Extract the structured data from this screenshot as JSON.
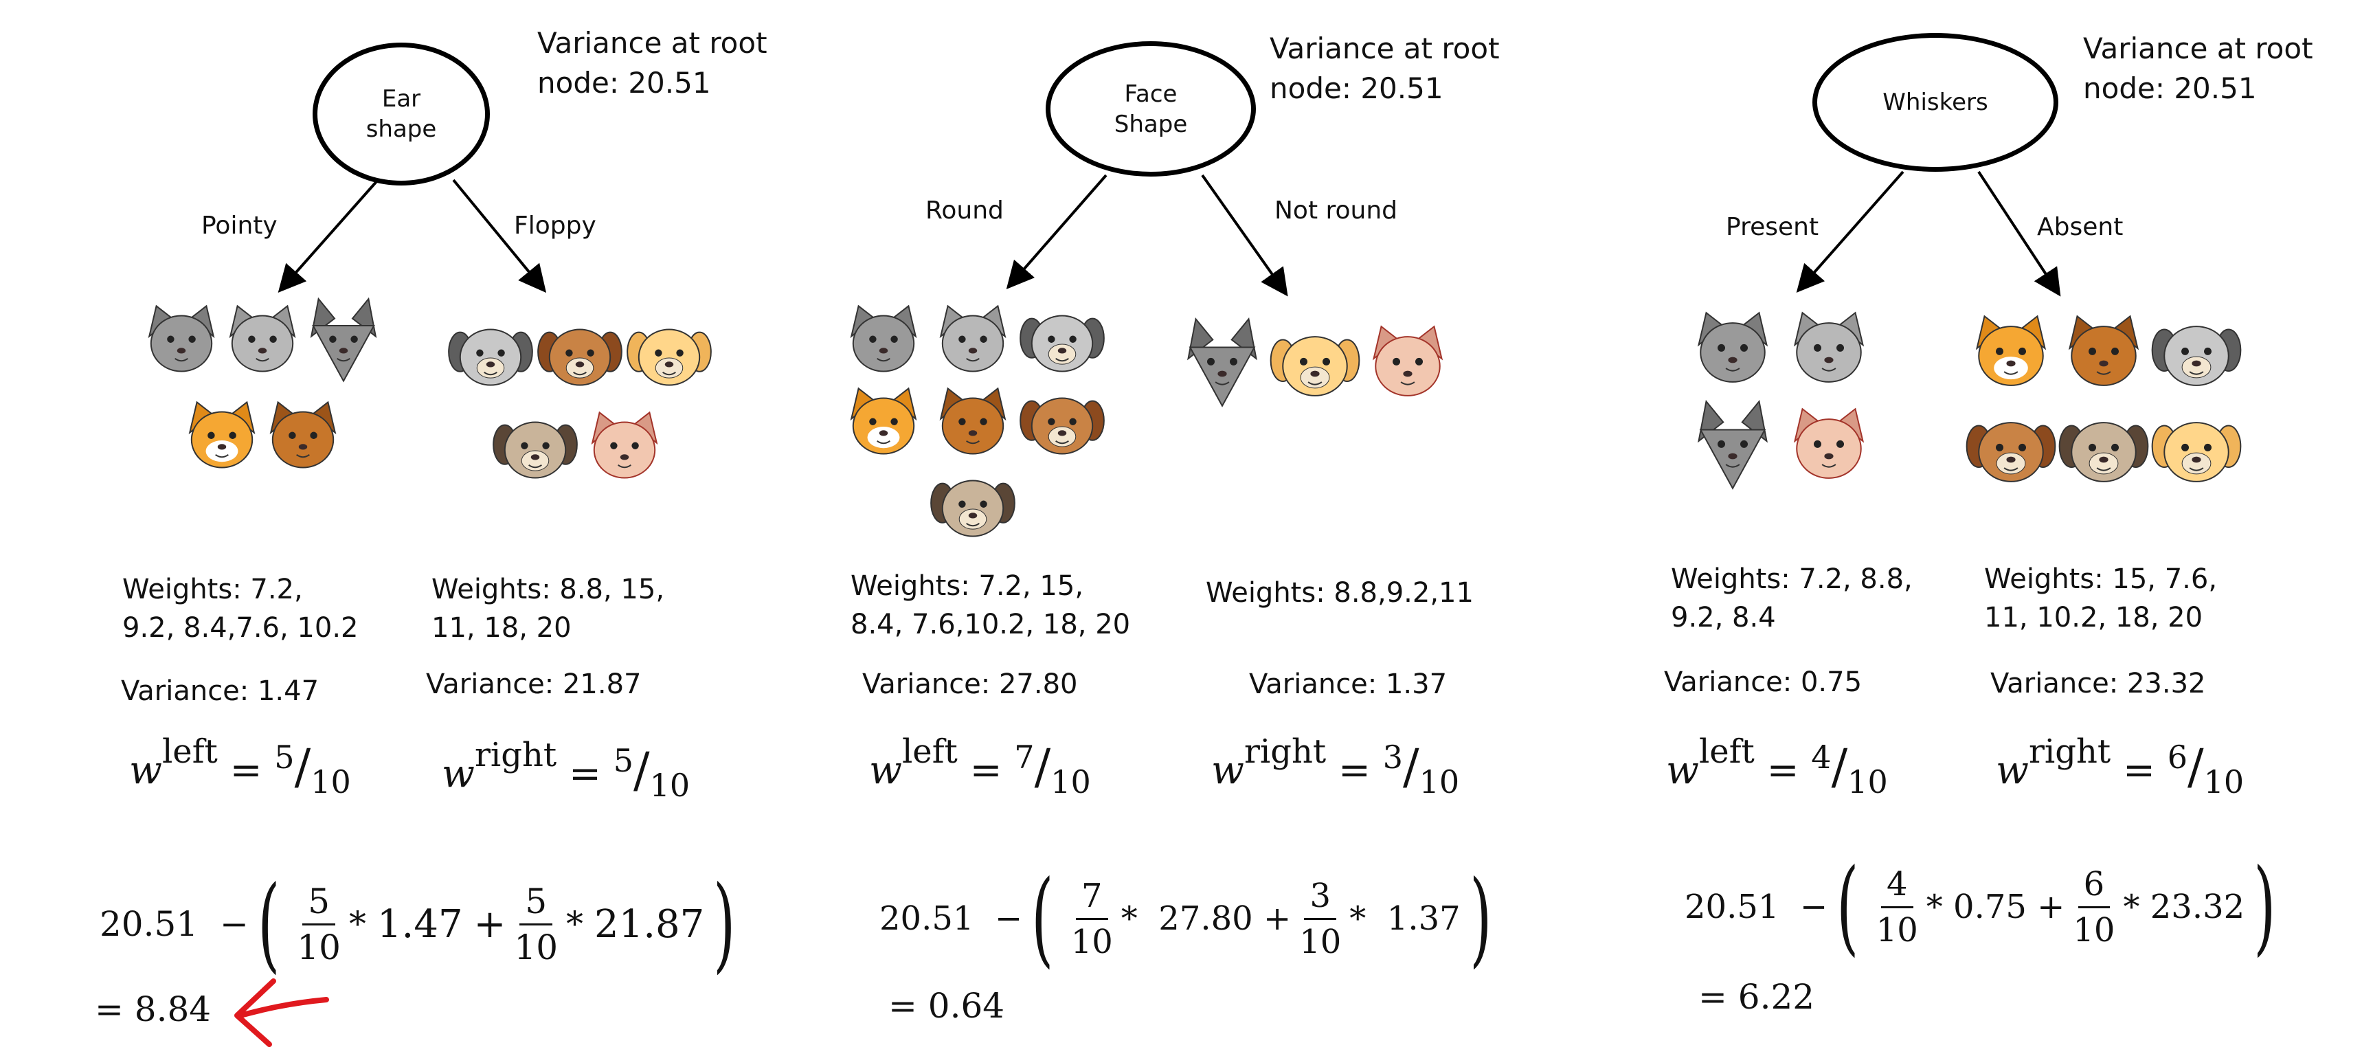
{
  "splits": [
    {
      "feature": [
        "Ear",
        "shape"
      ],
      "root_variance": "Variance at root\nnode: 20.51",
      "left_branch": "Pointy",
      "right_branch": "Floppy",
      "left_weights": "Weights: 7.2,\n9.2, 8.4,7.6, 10.2",
      "right_weights": "Weights: 8.8, 15,\n11, 18, 20",
      "left_variance": "Variance: 1.47",
      "right_variance": "Variance: 21.87",
      "w_left": {
        "num": "5",
        "den": "10"
      },
      "w_right": {
        "num": "5",
        "den": "10"
      },
      "formula": {
        "root": "20.51",
        "minus": "−",
        "left_num": "5",
        "left_den": "10",
        "left_var": "1.47",
        "right_num": "5",
        "right_den": "10",
        "right_var": "21.87"
      },
      "result": "= 8.84",
      "animals_left": [
        "cat-gray",
        "cat-gray-small",
        "cat-wolf",
        "cat-orange-white",
        "cat-brown"
      ],
      "animals_right": [
        "dog-gray",
        "dog-brown",
        "dog-tan",
        "dog-pug",
        "cat-pink"
      ]
    },
    {
      "feature": [
        "Face",
        "Shape"
      ],
      "root_variance": "Variance at root\nnode: 20.51",
      "left_branch": "Round",
      "right_branch": "Not round",
      "left_weights": "Weights: 7.2, 15,\n8.4, 7.6,10.2, 18, 20",
      "right_weights": "Weights: 8.8,9.2,11",
      "left_variance": "Variance: 27.80",
      "right_variance": "Variance: 1.37",
      "w_left": {
        "num": "7",
        "den": "10"
      },
      "w_right": {
        "num": "3",
        "den": "10"
      },
      "formula": {
        "root": "20.51",
        "minus": "−",
        "left_num": "7",
        "left_den": "10",
        "left_var": "27.80",
        "right_num": "3",
        "right_den": "10",
        "right_var": "1.37"
      },
      "result": "= 0.64",
      "animals_left": [
        "cat-gray",
        "cat-gray-small",
        "dog-gray",
        "cat-orange-white",
        "cat-brown",
        "dog-brown",
        "dog-pug"
      ],
      "animals_right": [
        "cat-wolf",
        "dog-tan",
        "cat-pink"
      ]
    },
    {
      "feature": [
        "Whiskers"
      ],
      "root_variance": "Variance at root\nnode: 20.51",
      "left_branch": "Present",
      "right_branch": "Absent",
      "left_weights": "Weights: 7.2, 8.8,\n9.2, 8.4",
      "right_weights": "Weights: 15, 7.6,\n11, 10.2, 18, 20",
      "left_variance": "Variance: 0.75",
      "right_variance": "Variance: 23.32",
      "w_left": {
        "num": "4",
        "den": "10"
      },
      "w_right": {
        "num": "6",
        "den": "10"
      },
      "formula": {
        "root": "20.51",
        "minus": "−",
        "left_num": "4",
        "left_den": "10",
        "left_var": "0.75",
        "right_num": "6",
        "right_den": "10",
        "right_var": "23.32"
      },
      "result": "= 6.22",
      "animals_left": [
        "cat-gray",
        "cat-gray-small",
        "cat-wolf",
        "cat-pink"
      ],
      "animals_right": [
        "cat-orange-white",
        "cat-brown",
        "dog-gray",
        "dog-brown",
        "dog-pug",
        "dog-tan"
      ]
    }
  ],
  "labels": {
    "w": "w",
    "left": "left",
    "right": "right",
    "eq": "=",
    "times": "*",
    "plus": "+"
  },
  "colors": {
    "highlight_arrow": "#e0191e",
    "ink": "#111111"
  }
}
